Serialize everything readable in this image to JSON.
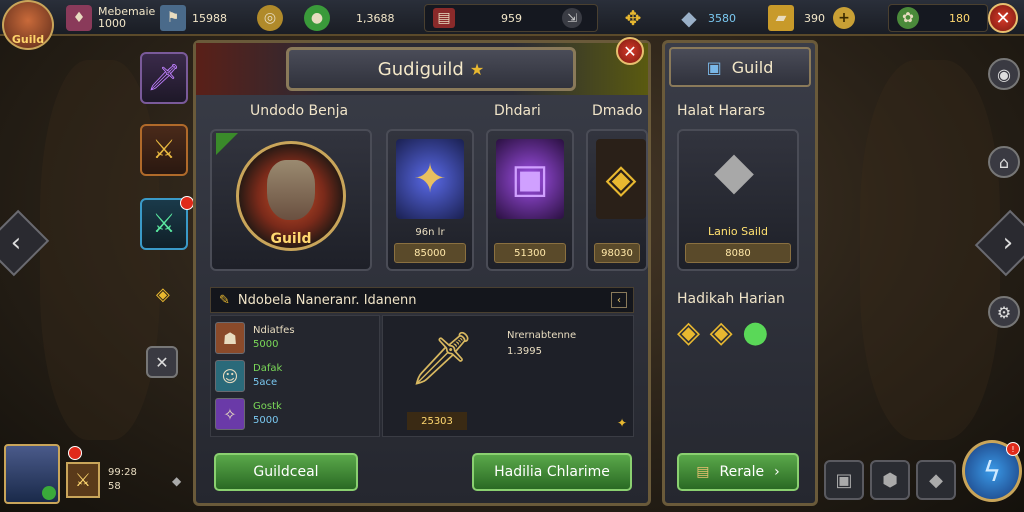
{
  "top_bar": {
    "avatar_label": "Guild",
    "player_name": "Mebemaie",
    "player_sub": "1000",
    "res1_value": "15988",
    "res2_value": "1,3688",
    "res3_value": "959",
    "res4_value": "3580",
    "res5_value": "390",
    "res6_value": "180"
  },
  "main_panel": {
    "title": "Gudiguild",
    "col1_head": "Undodo Benja",
    "col2_head": "Dhdari",
    "col3_head": "Dmado",
    "featured": {
      "label": "Guild"
    },
    "shop": [
      {
        "name": "96n lr",
        "price": "85000"
      },
      {
        "name": "",
        "price": "51300"
      },
      {
        "name": "",
        "price": "98030"
      }
    ],
    "quest_title": "Ndobela Naneranr. Idanenn",
    "quests": [
      {
        "a": "Ndiatfes",
        "b": "5000"
      },
      {
        "a": "Dafak",
        "b": "5ace"
      },
      {
        "a": "Gostk",
        "b": "5000"
      }
    ],
    "detail_price": "25303",
    "detail_lines": [
      "Nrernabtenne",
      "1.3995"
    ],
    "btn_left": "Guildceal",
    "btn_right": "Hadilia Chlarime"
  },
  "right_panel": {
    "title": "Guild",
    "head1": "Halat Harars",
    "card_name": "Lanio Saild",
    "card_price": "8080",
    "head2": "Hadikah Harian",
    "btn": "Rerale"
  },
  "bottom_left": {
    "line1": "99:28",
    "line2": "58"
  }
}
